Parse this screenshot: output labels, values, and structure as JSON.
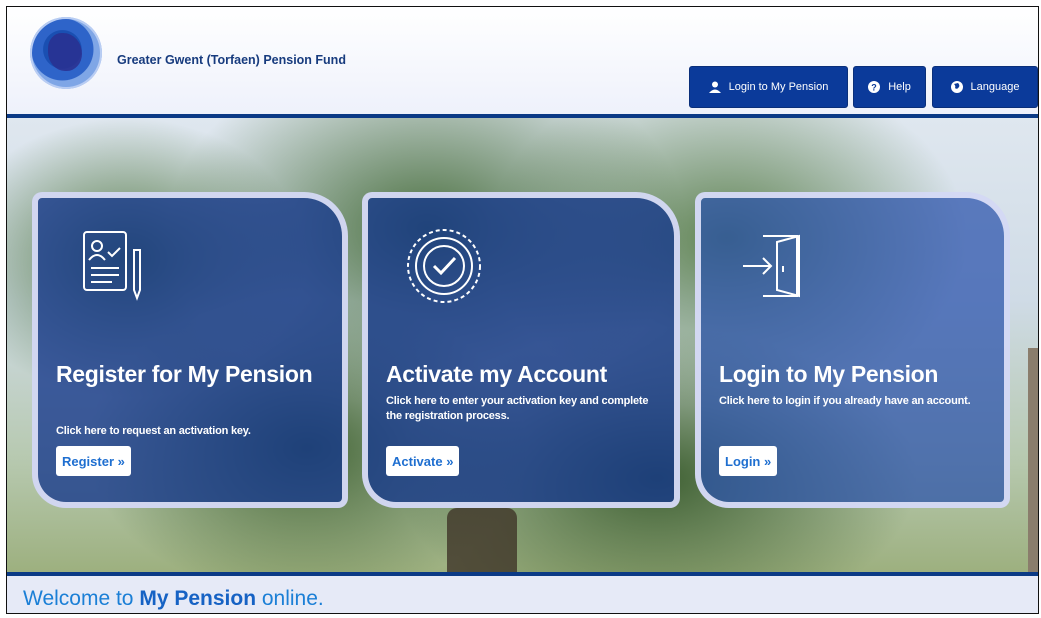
{
  "header": {
    "fund_name": "Greater Gwent (Torfaen) Pension Fund",
    "logo_icon": "fund-logo-icon",
    "nav": [
      {
        "label": "Login to My Pension",
        "icon": "user-icon"
      },
      {
        "label": "Help",
        "icon": "help-icon"
      },
      {
        "label": "Language",
        "icon": "globe-icon"
      }
    ]
  },
  "cards": [
    {
      "title": "Register for My Pension",
      "description": "Click here to request an activation key.",
      "button": "Register »",
      "icon": "registration-document-icon"
    },
    {
      "title": "Activate my Account",
      "description": "Click here to enter your activation key and complete the registration process.",
      "button": "Activate »",
      "icon": "activation-check-icon"
    },
    {
      "title": "Login to My Pension",
      "description": "Click here to login if you already have an account.",
      "button": "Login »",
      "icon": "login-door-icon"
    }
  ],
  "welcome": {
    "prefix": "Welcome to ",
    "highlight": "My Pension",
    "suffix": " online."
  },
  "colors": {
    "brand_blue": "#0b3a9a",
    "link_blue": "#1b7fd6",
    "card_overlay": "rgba(20,55,140,.78)"
  }
}
